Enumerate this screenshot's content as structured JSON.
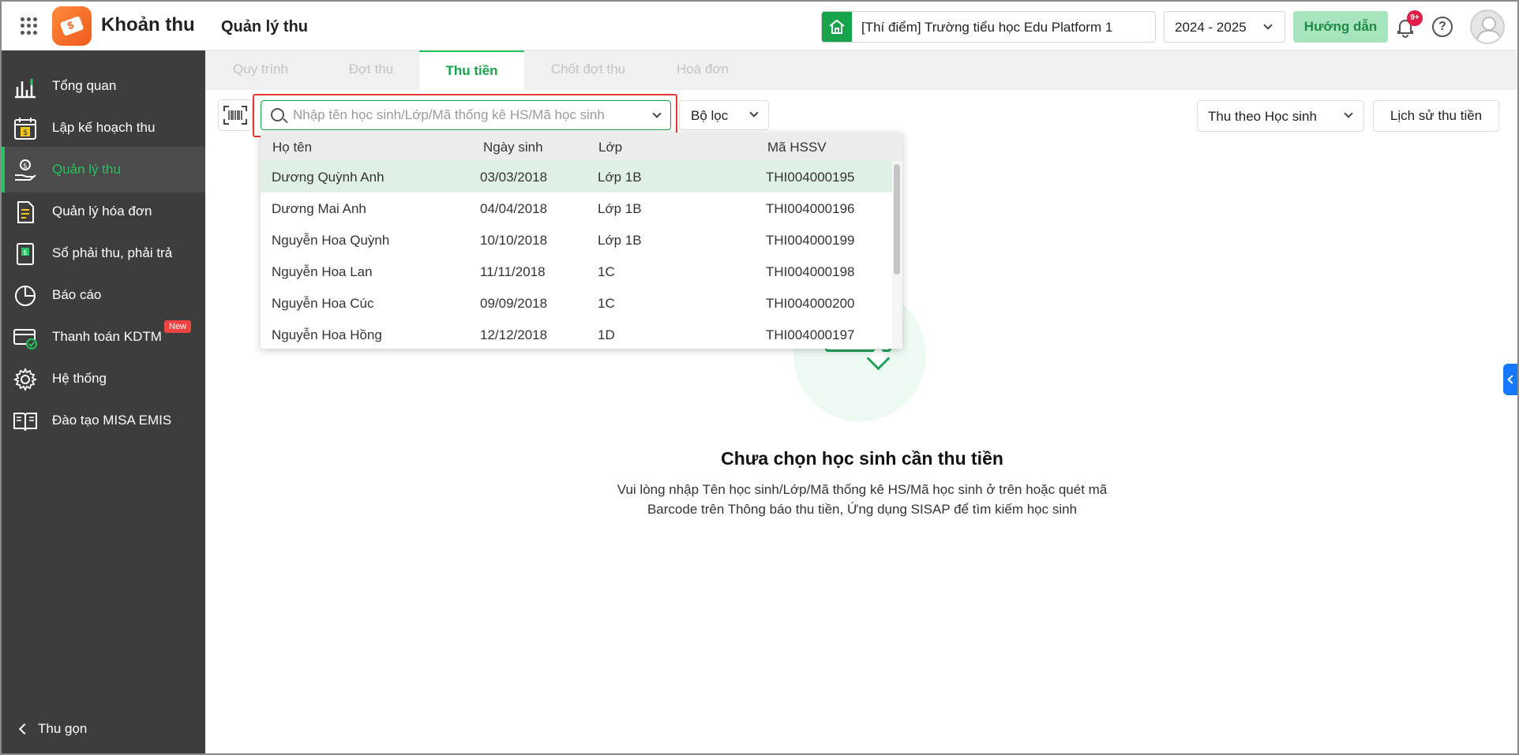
{
  "header": {
    "app_title": "Khoản thu",
    "page_title": "Quản lý thu",
    "school": "[Thí điểm] Trường tiểu học Edu Platform 1",
    "year": "2024 - 2025",
    "guide_label": "Hướng dẫn",
    "notification_badge": "9+",
    "help_label": "?"
  },
  "sidebar": {
    "items": [
      {
        "label": "Tổng quan",
        "icon": "chart-icon"
      },
      {
        "label": "Lập kế hoạch thu",
        "icon": "calendar-money-icon"
      },
      {
        "label": "Quản lý thu",
        "icon": "money-hand-icon",
        "active": true
      },
      {
        "label": "Quản lý hóa đơn",
        "icon": "invoice-icon"
      },
      {
        "label": "Sổ phải thu, phải trả",
        "icon": "ledger-icon"
      },
      {
        "label": "Báo cáo",
        "icon": "pie-chart-icon"
      },
      {
        "label": "Thanh toán KDTM",
        "icon": "card-check-icon",
        "badge": "New"
      },
      {
        "label": "Hệ thống",
        "icon": "gear-icon"
      },
      {
        "label": "Đào tạo MISA EMIS",
        "icon": "book-icon"
      }
    ],
    "collapse_label": "Thu gọn"
  },
  "tabs": [
    {
      "label": "Quy trình"
    },
    {
      "label": "Đợt thu"
    },
    {
      "label": "Thu tiền",
      "active": true
    },
    {
      "label": "Chốt đợt thu"
    },
    {
      "label": "Hoá đơn"
    }
  ],
  "toolbar": {
    "search_placeholder": "Nhập tên học sinh/Lớp/Mã thống kê HS/Mã học sinh",
    "filter_label": "Bộ lọc",
    "mode_label": "Thu theo Học sinh",
    "history_label": "Lịch sử thu tiền"
  },
  "dropdown": {
    "columns": [
      "Họ tên",
      "Ngày sinh",
      "Lớp",
      "Mã HSSV"
    ],
    "rows": [
      {
        "name": "Dương Quỳnh Anh",
        "dob": "03/03/2018",
        "class": "Lớp 1B",
        "code": "THI004000195"
      },
      {
        "name": "Dương Mai Anh",
        "dob": "04/04/2018",
        "class": "Lớp 1B",
        "code": "THI004000196"
      },
      {
        "name": "Nguyễn Hoa Quỳnh",
        "dob": "10/10/2018",
        "class": "Lớp 1B",
        "code": "THI004000199"
      },
      {
        "name": "Nguyễn Hoa Lan",
        "dob": "11/11/2018",
        "class": "1C",
        "code": "THI004000198"
      },
      {
        "name": "Nguyễn Hoa Cúc",
        "dob": "09/09/2018",
        "class": "1C",
        "code": "THI004000200"
      },
      {
        "name": "Nguyễn Hoa Hồng",
        "dob": "12/12/2018",
        "class": "1D",
        "code": "THI004000197"
      }
    ]
  },
  "empty_state": {
    "title": "Chưa chọn học sinh cần thu tiền",
    "desc_line1": "Vui lòng nhập Tên học sinh/Lớp/Mã thống kê HS/Mã học sinh ở trên hoặc quét mã",
    "desc_line2": "Barcode trên Thông báo thu tiền, Ứng dụng SISAP để tìm kiếm học sinh"
  },
  "colors": {
    "accent": "#22c55e",
    "sidebar_bg": "#3d3d3d",
    "highlight_border": "#e53935",
    "selected_row": "#dff1e4"
  }
}
